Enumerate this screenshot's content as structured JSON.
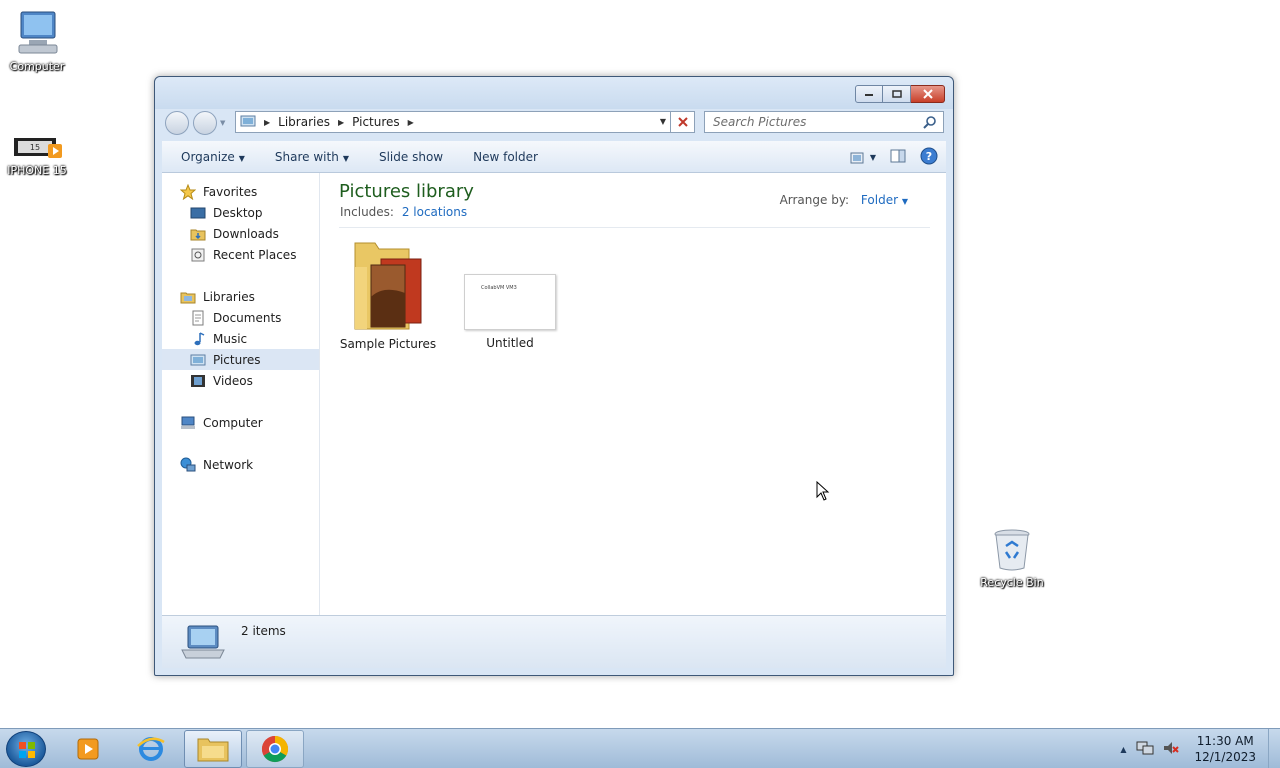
{
  "desktop": {
    "icons": [
      {
        "label": "Computer"
      },
      {
        "label": "IPHONE 15"
      },
      {
        "label": "Recycle Bin"
      }
    ]
  },
  "window": {
    "address": {
      "crumbs": [
        "Libraries",
        "Pictures"
      ]
    },
    "search": {
      "placeholder": "Search Pictures"
    },
    "toolbar": {
      "organize": "Organize",
      "share_with": "Share with",
      "slide_show": "Slide show",
      "new_folder": "New folder"
    },
    "nav": {
      "favorites": "Favorites",
      "desktop": "Desktop",
      "downloads": "Downloads",
      "recent_places": "Recent Places",
      "libraries": "Libraries",
      "documents": "Documents",
      "music": "Music",
      "pictures": "Pictures",
      "videos": "Videos",
      "computer": "Computer",
      "network": "Network"
    },
    "library": {
      "title": "Pictures library",
      "includes_label": "Includes:",
      "includes_link": "2 locations",
      "arrange_label": "Arrange by:",
      "arrange_value": "Folder"
    },
    "items": [
      {
        "label": "Sample Pictures"
      },
      {
        "label": "Untitled",
        "thumb_text": "CollabVM VM3"
      }
    ],
    "details": {
      "count": "2 items"
    }
  },
  "taskbar": {
    "clock": {
      "time": "11:30 AM",
      "date": "12/1/2023"
    }
  },
  "colors": {
    "library_title": "#1e5d1e",
    "link": "#1f6bc0",
    "selection": "#dbe6f4"
  }
}
